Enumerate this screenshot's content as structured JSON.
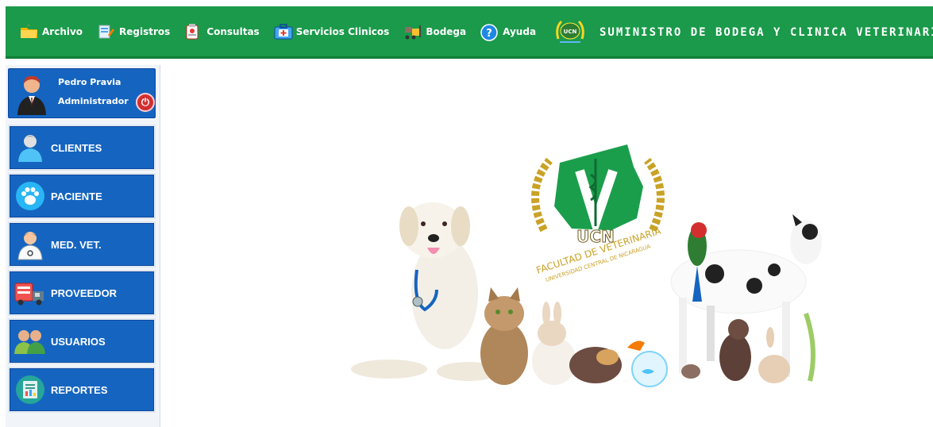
{
  "menu": [
    {
      "label": "Archivo",
      "icon": "folder-icon"
    },
    {
      "label": "Registros",
      "icon": "registry-icon"
    },
    {
      "label": "Consultas",
      "icon": "clipboard-icon"
    },
    {
      "label": "Servicios Clinicos",
      "icon": "medical-kit-icon"
    },
    {
      "label": "Bodega",
      "icon": "forklift-icon"
    },
    {
      "label": "Ayuda",
      "icon": "help-icon"
    }
  ],
  "brand": {
    "logo_text": "UCN",
    "title": "SUMINISTRO DE BODEGA Y CLINICA VETERINARIA"
  },
  "user": {
    "name": "Pedro Pravia",
    "role": "Administrador",
    "logout_icon": "power-icon"
  },
  "nav": [
    {
      "label": "CLIENTES",
      "icon": "client-icon"
    },
    {
      "label": "PACIENTE",
      "icon": "paw-icon"
    },
    {
      "label": "MED. VET.",
      "icon": "doctor-icon"
    },
    {
      "label": "PROVEEDOR",
      "icon": "truck-icon"
    },
    {
      "label": "USUARIOS",
      "icon": "users-icon"
    },
    {
      "label": "REPORTES",
      "icon": "report-icon"
    }
  ],
  "hero": {
    "logo_text": "UCN",
    "logo_arc_top": "FACULTAD DE VETERINARIA",
    "logo_arc_bottom": "UNIVERSIDAD CENTRAL DE NICARAGUA"
  },
  "colors": {
    "topbar": "#1a9a4a",
    "nav_button": "#1565c0",
    "logo_green": "#1b9e4b",
    "logo_gold": "#c9a227"
  }
}
